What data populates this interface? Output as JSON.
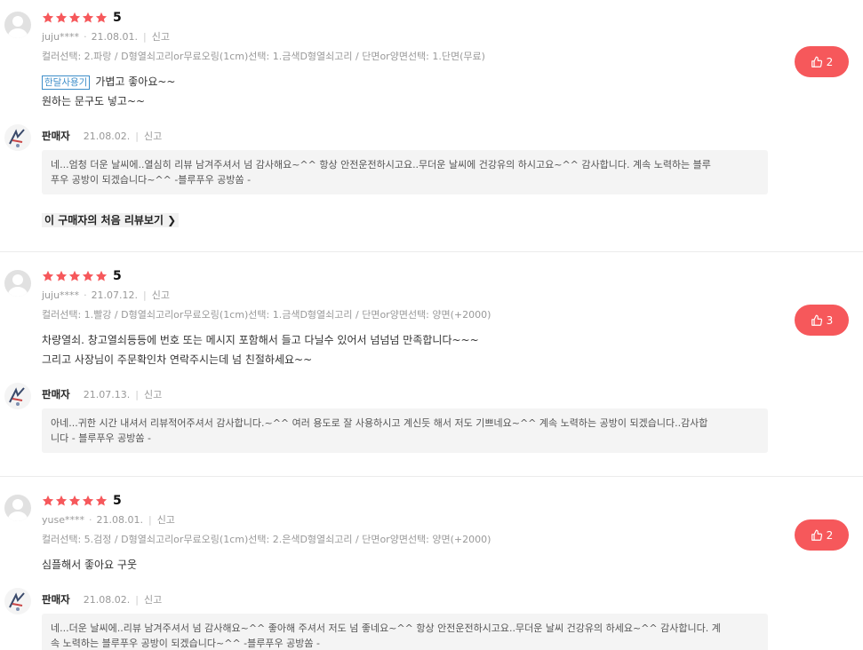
{
  "colors": {
    "star": "#f6585b",
    "like_bg": "#f6585b",
    "badge": "#3d8ec9",
    "reply_bg": "#f4f4f4"
  },
  "labels": {
    "report": "신고",
    "seller": "판매자",
    "first_review_link": "이 구매자의 처음 리뷰보기"
  },
  "reviews": [
    {
      "score": "5",
      "user": "juju****",
      "date": "21.08.01.",
      "option": "컬러선택: 2.파랑 / D형열쇠고리or무료오링(1cm)선택: 1.금색D형열쇠고리 / 단면or양면선택: 1.단면(무료)",
      "badge": "한달사용기",
      "lines": [
        "가볍고  좋아요~~",
        "원하는 문구도 넣고~~"
      ],
      "likes": "2",
      "reply_date": "21.08.02.",
      "reply": [
        "네...엄청 더운 날씨에..열심히 리뷰 남겨주셔서 넘 감사해요~^^  항상 안전운전하시고요..무더운 날씨에 건강유의 하시고요~^^ 감사합니다. 계속 노력하는 블루",
        "푸우 공방이 되겠습니다~^^  -블루푸우 공방쏨 -"
      ]
    },
    {
      "score": "5",
      "user": "juju****",
      "date": "21.07.12.",
      "option": "컬러선택: 1.빨강 / D형열쇠고리or무료오링(1cm)선택: 1.금색D형열쇠고리 / 단면or양면선택: 양면(+2000)",
      "lines": [
        "차량열쇠. 창고열쇠등등에   번호  또는 메시지 포함해서  들고 다닐수 있어서 넘넘넘  만족합니다~~~",
        "그리고  사장님이  주문확인차  연락주시는데  넘 친절하세요~~"
      ],
      "likes": "3",
      "reply_date": "21.07.13.",
      "reply": [
        "아네...귀한 시간 내셔서 리뷰적어주셔서 감사합니다.~^^   여러 용도로 잘 사용하시고 계신듯 해서 저도 기쁘네요~^^ 계속 노력하는 공방이 되겠습니다..감사합",
        "니다  - 블루푸우 공방쏨 -"
      ]
    },
    {
      "score": "5",
      "user": "yuse****",
      "date": "21.08.01.",
      "option": "컬러선택: 5.검정 / D형열쇠고리or무료오링(1cm)선택: 2.은색D형열쇠고리 / 단면or양면선택: 양면(+2000)",
      "lines": [
        "심플해서 좋아요 구웃"
      ],
      "likes": "2",
      "reply_date": "21.08.02.",
      "reply": [
        "네...더운 날씨에..리뷰 남겨주셔서 넘 감사해요~^^ 좋아해 주셔서 저도 넘 좋네요~^^ 항상 안전운전하시고요..무더운 날씨 건강유의 하세요~^^ 감사합니다. 계",
        "속 노력하는 블루푸우 공방이 되겠습니다~^^  -블루푸우 공방쏨 -"
      ]
    }
  ]
}
